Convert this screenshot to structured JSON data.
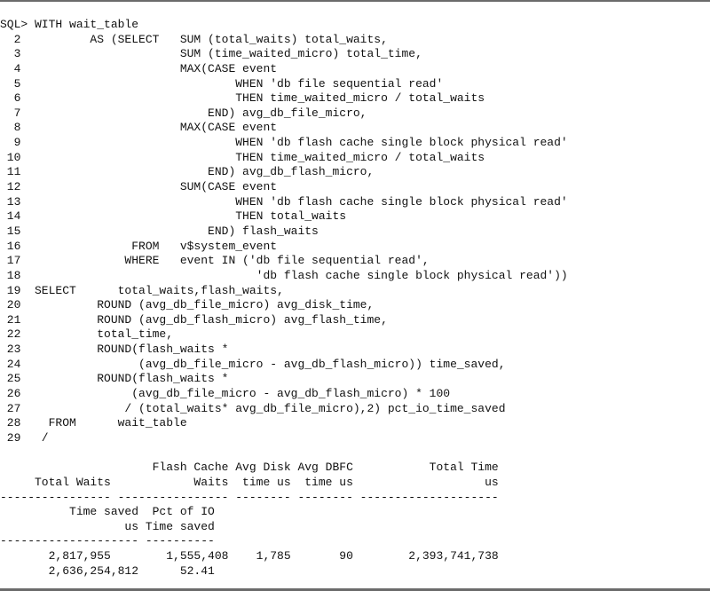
{
  "terminal": {
    "query_lines": [
      "SQL> WITH wait_table",
      "  2          AS (SELECT   SUM (total_waits) total_waits,",
      "  3                       SUM (time_waited_micro) total_time,",
      "  4                       MAX(CASE event",
      "  5                               WHEN 'db file sequential read'",
      "  6                               THEN time_waited_micro / total_waits",
      "  7                           END) avg_db_file_micro,",
      "  8                       MAX(CASE event",
      "  9                               WHEN 'db flash cache single block physical read'",
      " 10                               THEN time_waited_micro / total_waits",
      " 11                           END) avg_db_flash_micro,",
      " 12                       SUM(CASE event",
      " 13                               WHEN 'db flash cache single block physical read'",
      " 14                               THEN total_waits",
      " 15                           END) flash_waits",
      " 16                FROM   v$system_event",
      " 17               WHERE   event IN ('db file sequential read',",
      " 18                                  'db flash cache single block physical read'))",
      " 19  SELECT      total_waits,flash_waits,",
      " 20           ROUND (avg_db_file_micro) avg_disk_time,",
      " 21           ROUND (avg_db_flash_micro) avg_flash_time,",
      " 22           total_time,",
      " 23           ROUND(flash_waits *",
      " 24                 (avg_db_file_micro - avg_db_flash_micro)) time_saved,",
      " 25           ROUND(flash_waits *",
      " 26                (avg_db_file_micro - avg_db_flash_micro) * 100",
      " 27               / (total_waits* avg_db_file_micro),2) pct_io_time_saved",
      " 28    FROM      wait_table",
      " 29   /"
    ],
    "result_lines": [
      "",
      "                      Flash Cache Avg Disk Avg DBFC           Total Time",
      "     Total Waits            Waits  time us  time us                   us",
      "---------------- ---------------- -------- -------- --------------------",
      "          Time saved  Pct of IO",
      "                  us Time saved",
      "-------------------- ----------",
      "       2,817,955        1,555,408    1,785       90        2,393,741,738",
      "       2,636,254,812      52.41"
    ]
  }
}
